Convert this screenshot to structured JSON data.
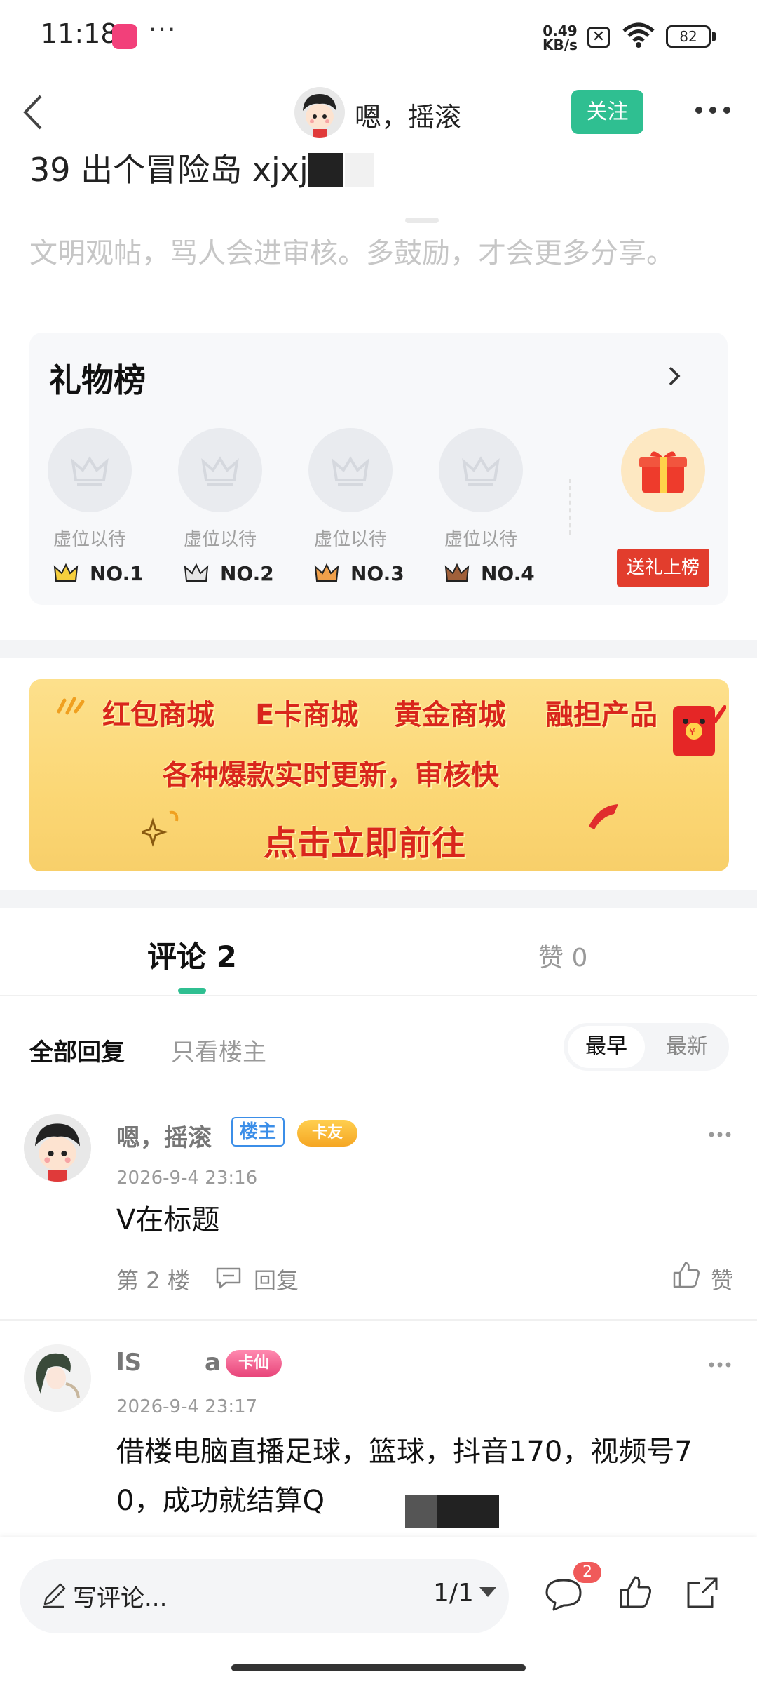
{
  "status_bar": {
    "time": "11:18",
    "more": "···",
    "net_speed_value": "0.49",
    "net_speed_unit": "KB/s",
    "battery": "82"
  },
  "header": {
    "title": "嗯，摇滚",
    "follow_label": "关注"
  },
  "post": {
    "title_visible": "39 出个冒险岛 xjxj",
    "notice": "文明观帖，骂人会进审核。多鼓励，才会更多分享。"
  },
  "gift_board": {
    "title": "礼物榜",
    "slots": [
      {
        "label": "虚位以待",
        "rank": "NO.1",
        "crown_color": "#e8b21f"
      },
      {
        "label": "虚位以待",
        "rank": "NO.2",
        "crown_color": "#9a9a9a"
      },
      {
        "label": "虚位以待",
        "rank": "NO.3",
        "crown_color": "#e08a3c"
      },
      {
        "label": "虚位以待",
        "rank": "NO.4",
        "crown_color": "#8b5a3c"
      }
    ],
    "send_gift_label": "送礼上榜"
  },
  "banner": {
    "items": [
      "红包商城",
      "E卡商城",
      "黄金商城",
      "融担产品"
    ],
    "subtitle": "各种爆款实时更新，审核快",
    "cta": "点击立即前往"
  },
  "tabs": {
    "comments_label": "评论 2",
    "likes_label": "赞 0"
  },
  "filters": {
    "all_label": "全部回复",
    "op_only_label": "只看楼主",
    "sort_earliest": "最早",
    "sort_latest": "最新"
  },
  "comments": [
    {
      "name": "嗯，摇滚",
      "op_badge": "楼主",
      "level_badge": "卡友",
      "time": "2026-9-4 23:16",
      "text": "V在标题",
      "floor": "第 2 楼",
      "reply_label": "回复",
      "like_label": "赞"
    },
    {
      "name_prefix": "lS",
      "name_suffix": "a",
      "level_badge": "卡仙",
      "time": "2026-9-4 23:17",
      "text_line1": "借楼电脑直播足球，篮球，抖音170，视频号7",
      "text_line2": "0，成功就结算Q"
    }
  ],
  "bottom_bar": {
    "input_placeholder": "写评论...",
    "page_indicator": "1/1",
    "comment_count": "2"
  },
  "colors": {
    "accent_green": "#2fbf91",
    "gift_red": "#e23d2d",
    "op_badge_blue": "#3b8ee8"
  }
}
